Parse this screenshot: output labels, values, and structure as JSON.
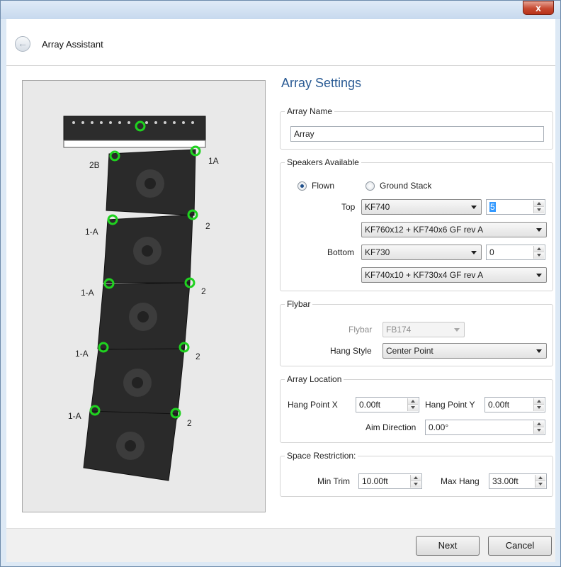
{
  "window": {
    "close_label": "x"
  },
  "header": {
    "title": "Array Assistant"
  },
  "preview": {
    "labels": [
      "2B",
      "1A",
      "1-A",
      "2",
      "1-A",
      "2",
      "1-A",
      "2",
      "1-A",
      "2"
    ]
  },
  "settings": {
    "title": "Array Settings",
    "array_name": {
      "legend": "Array Name",
      "value": "Array"
    },
    "speakers": {
      "legend": "Speakers Available",
      "flown_label": "Flown",
      "ground_label": "Ground Stack",
      "top_label": "Top",
      "top_model": "KF740",
      "top_count": "5",
      "top_config": "KF760x12 + KF740x6 GF rev A",
      "bottom_label": "Bottom",
      "bottom_model": "KF730",
      "bottom_count": "0",
      "bottom_config": "KF740x10 + KF730x4 GF rev A"
    },
    "flybar": {
      "legend": "Flybar",
      "flybar_label": "Flybar",
      "flybar_value": "FB174",
      "hang_style_label": "Hang Style",
      "hang_style_value": "Center Point"
    },
    "location": {
      "legend": "Array Location",
      "hang_x_label": "Hang Point X",
      "hang_x_value": "0.00ft",
      "hang_y_label": "Hang Point Y",
      "hang_y_value": "0.00ft",
      "aim_label": "Aim Direction",
      "aim_value": "0.00°"
    },
    "space": {
      "legend": "Space Restriction:",
      "min_trim_label": "Min Trim",
      "min_trim_value": "10.00ft",
      "max_hang_label": "Max Hang",
      "max_hang_value": "33.00ft"
    }
  },
  "footer": {
    "next_label": "Next",
    "cancel_label": "Cancel"
  }
}
